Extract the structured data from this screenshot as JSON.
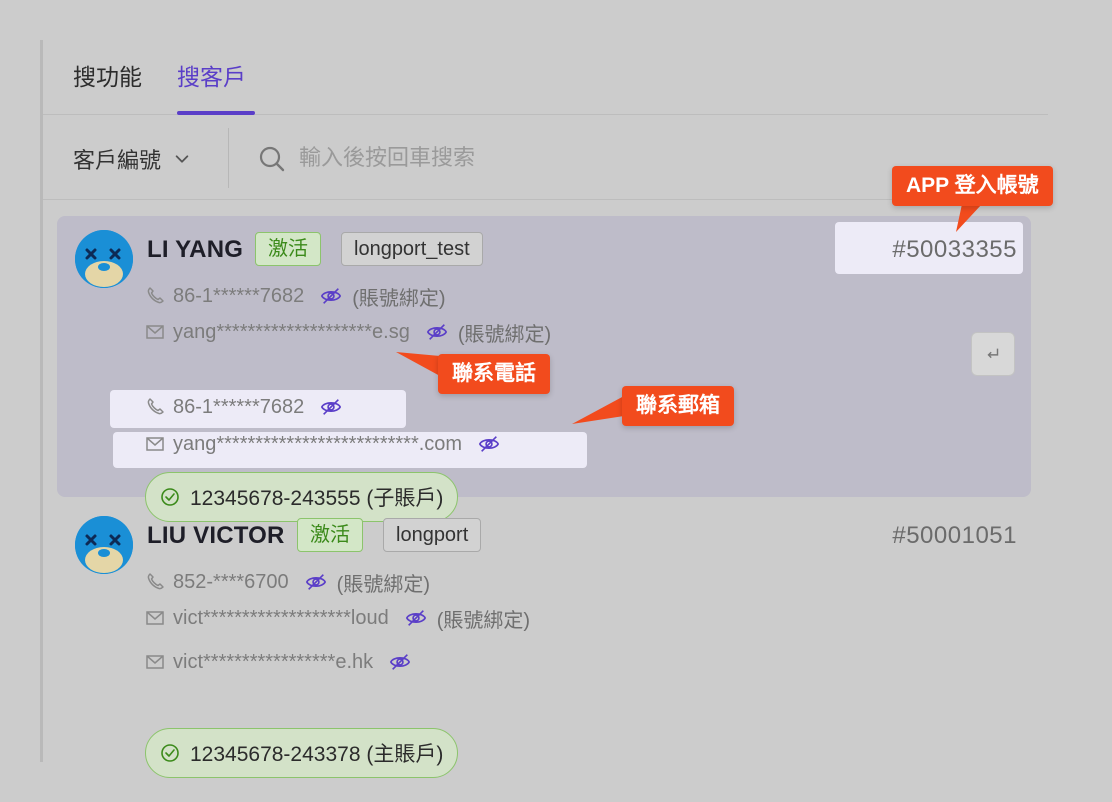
{
  "tabs": [
    {
      "label": "搜功能"
    },
    {
      "label": "搜客戶",
      "active": true
    }
  ],
  "search": {
    "field_selector": "客戶編號",
    "placeholder": "輸入後按回車搜索"
  },
  "colors": {
    "accent": "#5a3ec8",
    "callout": "#f24b1d",
    "active_badge": "#3b8a1a",
    "selected_card": "#bebcc9"
  },
  "customers": [
    {
      "name": "LI YANG",
      "status": "激活",
      "tag": "longport_test",
      "id": "#50033355",
      "account_phone": "86-1******7682",
      "account_phone_note": "(賬號綁定)",
      "account_email": "yang********************e.sg",
      "account_email_note": "(賬號綁定)",
      "contact_phone": "86-1******7682",
      "contact_email": "yang**************************.com",
      "account": "12345678-243555 (子賬戶)"
    },
    {
      "name": "LIU VICTOR",
      "status": "激活",
      "tag": "longport",
      "id": "#50001051",
      "account_phone": "852-****6700",
      "account_phone_note": "(賬號綁定)",
      "account_email": "vict*******************loud",
      "account_email_note": "(賬號綁定)",
      "contact_email": "vict*****************e.hk",
      "account": "12345678-243378 (主賬戶)"
    }
  ],
  "callouts": {
    "app_login": "APP 登入帳號",
    "contact_phone": "聯系電話",
    "contact_email": "聯系郵箱"
  },
  "icons": [
    "chevron-down-icon",
    "search-icon",
    "phone-icon",
    "mail-icon",
    "eye-slash-icon",
    "check-circle-icon",
    "enter-icon",
    "avatar-icon"
  ]
}
